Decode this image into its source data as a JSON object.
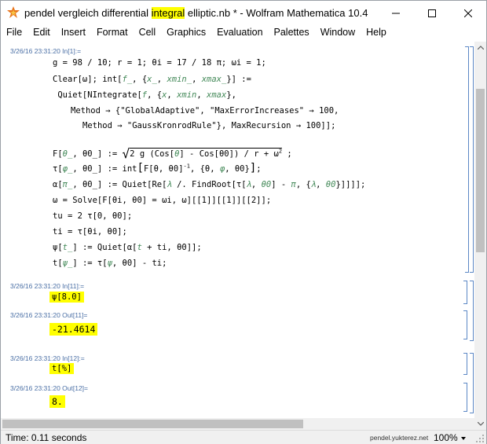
{
  "window": {
    "title_before": "pendel vergleich differential ",
    "title_highlight": "integral",
    "title_after": " elliptic.nb * - Wolfram Mathematica 10.4"
  },
  "menu": [
    "File",
    "Edit",
    "Insert",
    "Format",
    "Cell",
    "Graphics",
    "Evaluation",
    "Palettes",
    "Window",
    "Help"
  ],
  "cells": {
    "in1_label": "3/26/16 23:31:20 In[1]:=",
    "in11_label": "3/26/16 23:31:20 In[11]:=",
    "in11_code": "ψ[8.0]",
    "out11_label": "3/26/16 23:31:20 Out[11]=",
    "out11_value": "-21.4614",
    "in12_label": "3/26/16 23:31:20 In[12]:=",
    "in12_code": "t[%]",
    "out12_label": "3/26/16 23:31:20 Out[12]=",
    "out12_value": "8."
  },
  "code_lines": {
    "l1": "g = 98 / 10; r = 1; θi = 17 / 18 π; ωi = 1;",
    "l2a": "Clear[ω]; int[",
    "l2b": "f_",
    "l2c": ", {",
    "l2d": "x_",
    "l2e": ", ",
    "l2f": "xmin_",
    "l2g": ", ",
    "l2h": "xmax_",
    "l2i": "}] :=",
    "l3a": " Quiet[NIntegrate[",
    "l3b": "f",
    "l3c": ", {",
    "l3d": "x",
    "l3e": ", ",
    "l3f": "xmin",
    "l3g": ", ",
    "l3h": "xmax",
    "l3i": "},",
    "l4": "Method → {\"GlobalAdaptive\", \"MaxErrorIncreases\" → 100,",
    "l5": "Method → \"GaussKronrodRule\"}, MaxRecursion → 100]];",
    "l6a": "F[",
    "l6b": "θ_",
    "l6c": ", θ0_] := ",
    "l6d": "2 g (Cos[",
    "l6e": "θ",
    "l6f": "] - Cos[θ0]) / r + ω",
    "l6g": "2",
    "l6h": " ;",
    "l7a": "τ[",
    "l7b": "φ_",
    "l7c": ", θ0_] := int",
    "l7d": "F[θ, θ0]",
    "l7e": "-1",
    "l7f": ", {θ, ",
    "l7g": "φ",
    "l7h": ", θ0}",
    "l7i": ";",
    "l8a": "α[",
    "l8b": "π_",
    "l8c": ", θ0_] := Quiet[Re[",
    "l8d": "λ",
    "l8e": " /. FindRoot[τ[",
    "l8f": "λ",
    "l8g": ", ",
    "l8h": "θ0",
    "l8i": "] - ",
    "l8j": "π",
    "l8k": ", {",
    "l8l": "λ",
    "l8m": ", ",
    "l8n": "θ0",
    "l8o": "}]]]];",
    "l9": "ω = Solve[F[θi, θ0] = ωi, ω][[1]][[1]][[2]];",
    "l10": "tu = 2 τ[0, θ0];",
    "l11": "ti = τ[θi, θ0];",
    "l12a": "ψ[",
    "l12b": "t_",
    "l12c": "] := Quiet[α[",
    "l12d": "t",
    "l12e": " + ti, θ0]];",
    "l13a": "t[",
    "l13b": "ψ_",
    "l13c": "] := τ[",
    "l13d": "ψ",
    "l13e": ", θ0] - ti;"
  },
  "status": {
    "time": "Time: 0.11 seconds",
    "site": "pendel.yukterez.net",
    "zoom": "100%"
  },
  "colors": {
    "highlight": "#ffff00",
    "bracket": "#5b87c5",
    "pattern": "#438958",
    "label": "#4a6fa5"
  }
}
